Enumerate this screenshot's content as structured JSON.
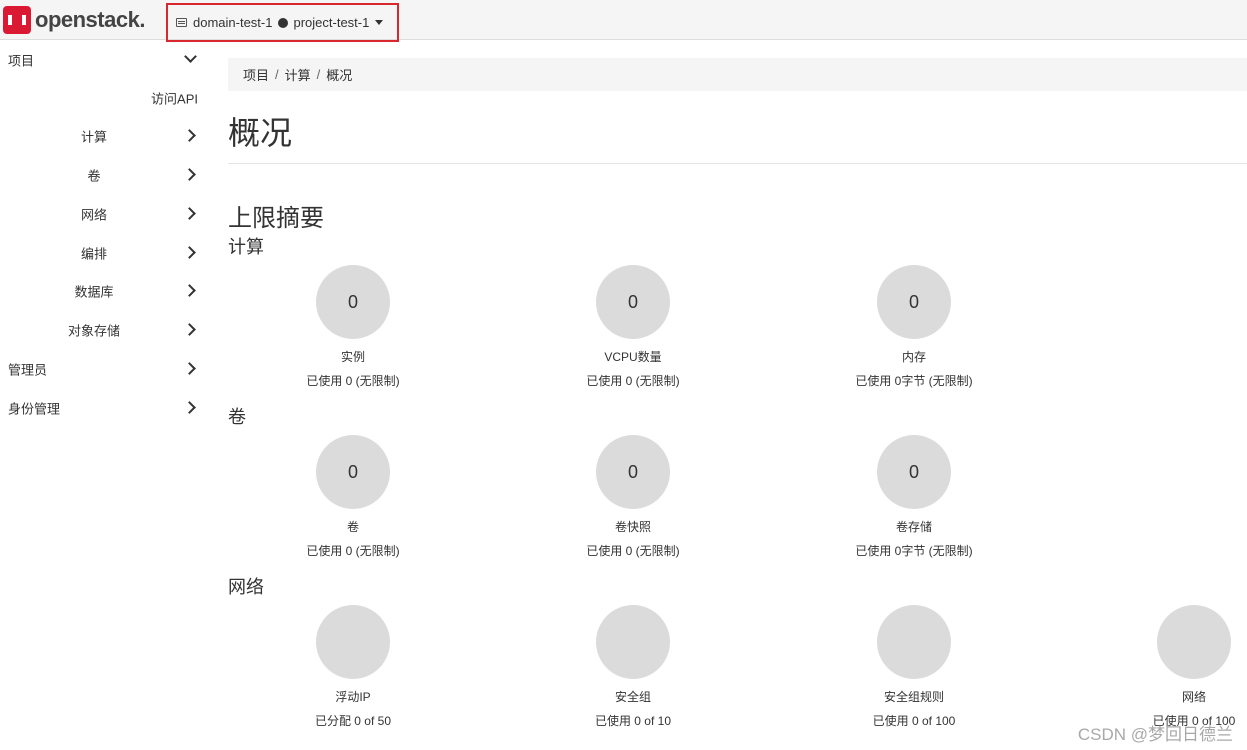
{
  "brand": {
    "name": "openstack",
    "mark": "."
  },
  "context": {
    "domain": "domain-test-1",
    "project": "project-test-1"
  },
  "sidebar": {
    "project": "项目",
    "access_api": "访问API",
    "items": [
      "计算",
      "卷",
      "网络",
      "编排",
      "数据库",
      "对象存储"
    ],
    "admin": "管理员",
    "identity": "身份管理"
  },
  "breadcrumb": [
    "项目",
    "计算",
    "概况"
  ],
  "page_title": "概况",
  "limits": {
    "heading": "上限摘要",
    "compute": {
      "title": "计算",
      "quotas": [
        {
          "value": "0",
          "label": "实例",
          "usage": "已使用 0 (无限制)"
        },
        {
          "value": "0",
          "label": "VCPU数量",
          "usage": "已使用 0 (无限制)"
        },
        {
          "value": "0",
          "label": "内存",
          "usage": "已使用 0字节 (无限制)"
        }
      ]
    },
    "volume": {
      "title": "卷",
      "quotas": [
        {
          "value": "0",
          "label": "卷",
          "usage": "已使用 0 (无限制)"
        },
        {
          "value": "0",
          "label": "卷快照",
          "usage": "已使用 0 (无限制)"
        },
        {
          "value": "0",
          "label": "卷存储",
          "usage": "已使用 0字节 (无限制)"
        }
      ]
    },
    "network": {
      "title": "网络",
      "quotas": [
        {
          "label": "浮动IP",
          "usage": "已分配 0 of 50"
        },
        {
          "label": "安全组",
          "usage": "已使用 0 of 10"
        },
        {
          "label": "安全组规则",
          "usage": "已使用 0 of 100"
        },
        {
          "label": "网络",
          "usage": "已使用 0 of 100"
        }
      ]
    }
  },
  "watermark": "CSDN @梦回日德兰",
  "colors": {
    "accent": "#da1a32",
    "highlight_box": "#d9282d",
    "pie_gray": "#dbdbdb"
  }
}
